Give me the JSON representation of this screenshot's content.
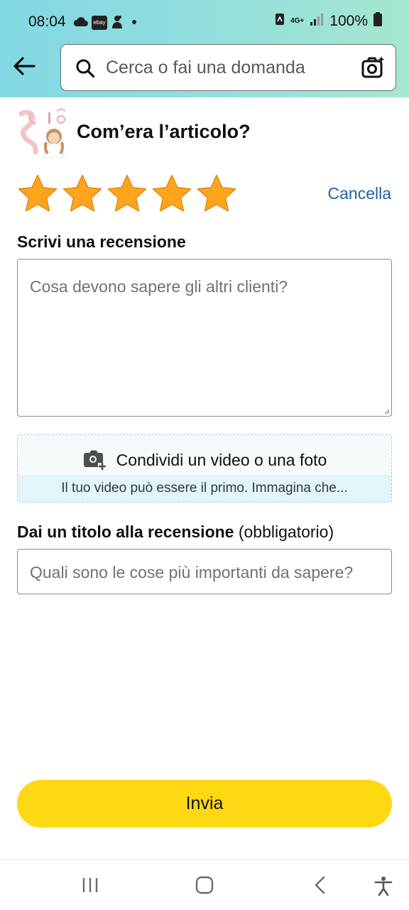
{
  "status_bar": {
    "time": "08:04",
    "ebay_label": "ebay",
    "network": "4G+",
    "battery": "100%"
  },
  "search": {
    "placeholder": "Cerca o fai una domanda"
  },
  "header": {
    "question": "Com’era l’articolo?"
  },
  "rating": {
    "value": 5,
    "max": 5,
    "star_color": "#ffa41c",
    "cancel_label": "Cancella"
  },
  "review": {
    "label": "Scrivi una recensione",
    "placeholder": "Cosa devono sapere gli altri clienti?"
  },
  "media": {
    "button_label": "Condividi un video o una foto",
    "hint": "Il tuo video può essere il primo. Immagina che..."
  },
  "title_field": {
    "label": "Dai un titolo alla recensione",
    "required_note": "(obbligatorio)",
    "placeholder": "Quali sono le cose più importanti da sapere?"
  },
  "submit": {
    "label": "Invia",
    "color": "#ffd814"
  },
  "colors": {
    "link": "#2162a1",
    "header_gradient_start": "#82d8e3",
    "header_gradient_end": "#a6e6d0"
  }
}
